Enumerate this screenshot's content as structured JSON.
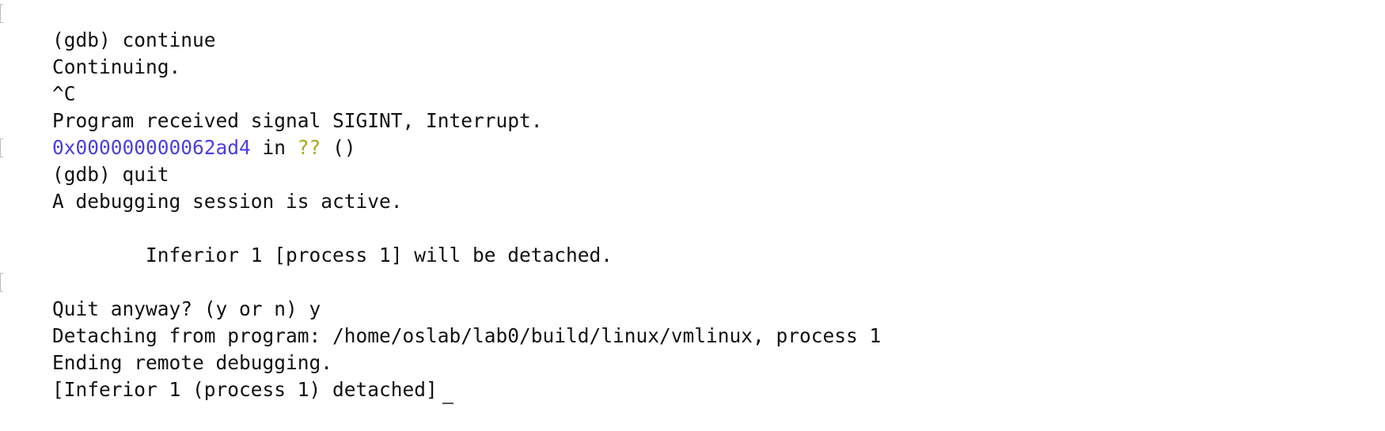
{
  "terminal": {
    "line_continue_cmd": "(gdb) continue",
    "line_continuing": "Continuing.",
    "line_ctrl_c": "^C",
    "line_signal": "Program received signal SIGINT, Interrupt.",
    "line_frame_address": "0x000000000062ad4",
    "line_frame_in": " in ",
    "line_frame_func": "??",
    "line_frame_args": " ()",
    "line_quit_cmd": "(gdb) quit",
    "line_session_active": "A debugging session is active.",
    "line_inferior_detach": "        Inferior 1 [process 1] will be detached.",
    "line_quit_prompt": "Quit anyway? (y or n) y",
    "line_detaching": "Detaching from program: /home/oslab/lab0/build/linux/vmlinux, process 1",
    "line_ending": "Ending remote debugging.",
    "line_detached": "[Inferior 1 (process 1) detached]"
  },
  "colors": {
    "background": "#ffffff",
    "text": "#111111",
    "address": "#4a3ee0",
    "unknown_function": "#a9a718",
    "prompt_marker": "#bdbdbd"
  }
}
